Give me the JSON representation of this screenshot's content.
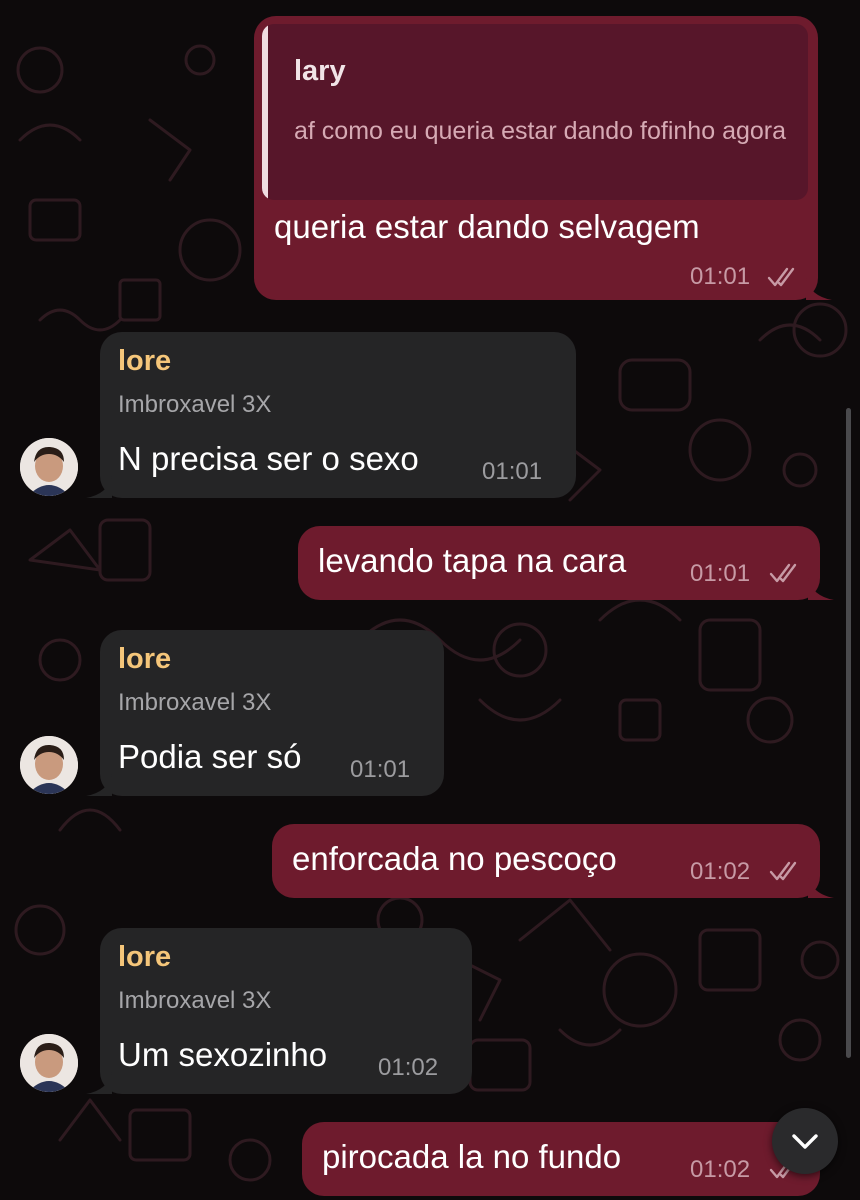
{
  "theme": {
    "outgoing_bubble": "#6e1b2d",
    "incoming_bubble": "#252526",
    "sender_name": "#f5c67a",
    "background": "#0d0a0b"
  },
  "messages": [
    {
      "direction": "outgoing",
      "reply_to": {
        "name": "lary",
        "text": "af como eu queria estar dando fofinho agora"
      },
      "text": "queria estar dando selvagem",
      "time": "01:01",
      "status": "read-double-check-icon"
    },
    {
      "direction": "incoming",
      "sender": "lore",
      "subtitle": "Imbroxavel 3X",
      "text": "N precisa ser o sexo",
      "time": "01:01"
    },
    {
      "direction": "outgoing",
      "text": "levando tapa na cara",
      "time": "01:01",
      "status": "read-double-check-icon"
    },
    {
      "direction": "incoming",
      "sender": "lore",
      "subtitle": "Imbroxavel 3X",
      "text": "Podia ser só",
      "time": "01:01"
    },
    {
      "direction": "outgoing",
      "text": "enforcada no pescoço",
      "time": "01:02",
      "status": "read-double-check-icon"
    },
    {
      "direction": "incoming",
      "sender": "lore",
      "subtitle": "Imbroxavel 3X",
      "text": "Um sexozinho",
      "time": "01:02"
    },
    {
      "direction": "outgoing",
      "text": "pirocada la no fundo",
      "time": "01:02",
      "status": "read-double-check-icon"
    }
  ],
  "scroll_down_button": {
    "icon": "chevron-down-icon"
  }
}
